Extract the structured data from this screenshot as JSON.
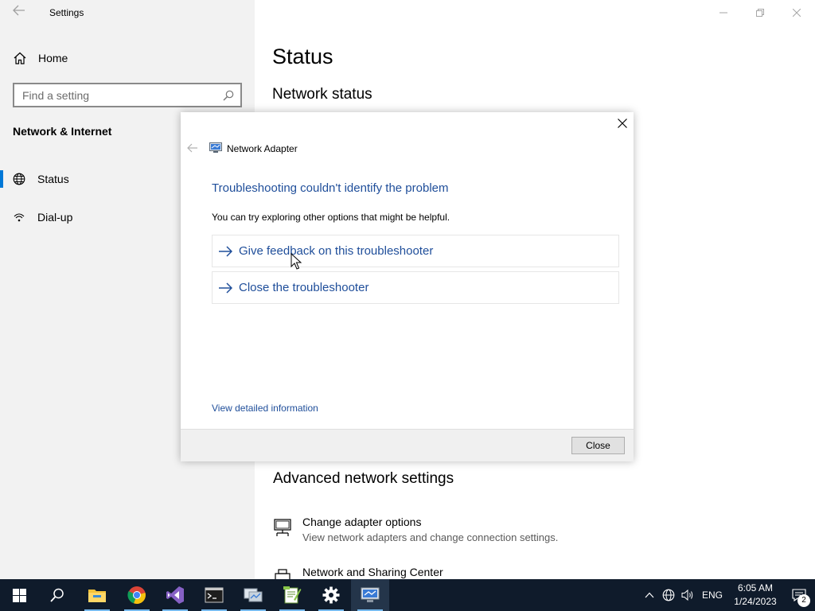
{
  "window": {
    "title": "Settings"
  },
  "sidebar": {
    "home_label": "Home",
    "search_placeholder": "Find a setting",
    "section_title": "Network & Internet",
    "items": [
      {
        "label": "Status",
        "icon": "globe-icon",
        "active": true
      },
      {
        "label": "Dial-up",
        "icon": "dialup-icon",
        "active": false
      }
    ]
  },
  "main": {
    "page_title": "Status",
    "network_status_heading": "Network status",
    "advanced_heading": "Advanced network settings",
    "links": [
      {
        "title": "Change adapter options",
        "subtitle": "View network adapters and change connection settings.",
        "icon": "monitor-network-icon"
      },
      {
        "title": "Network and Sharing Center",
        "subtitle": "",
        "icon": "printer-network-icon"
      }
    ]
  },
  "dialog": {
    "app_title": "Network Adapter",
    "heading": "Troubleshooting couldn't identify the problem",
    "subtext": "You can try exploring other options that might be helpful.",
    "options": [
      {
        "label": "Give feedback on this troubleshooter"
      },
      {
        "label": "Close the troubleshooter"
      }
    ],
    "detail_link": "View detailed information",
    "close_button": "Close"
  },
  "taskbar": {
    "apps": [
      "windows-start-icon",
      "search-icon",
      "file-explorer-icon",
      "chrome-icon",
      "visual-studio-icon",
      "terminal-icon",
      "network-tool-icon",
      "notepad-plus-icon",
      "settings-gear-icon",
      "troubleshooter-icon"
    ],
    "language": "ENG",
    "time": "6:05 AM",
    "date": "1/24/2023",
    "notification_count": "2"
  },
  "colors": {
    "accent": "#0078d7",
    "link_blue": "#1f4e9a",
    "sidebar_bg": "#f2f2f2",
    "taskbar_bg": "#0f1b2b"
  }
}
